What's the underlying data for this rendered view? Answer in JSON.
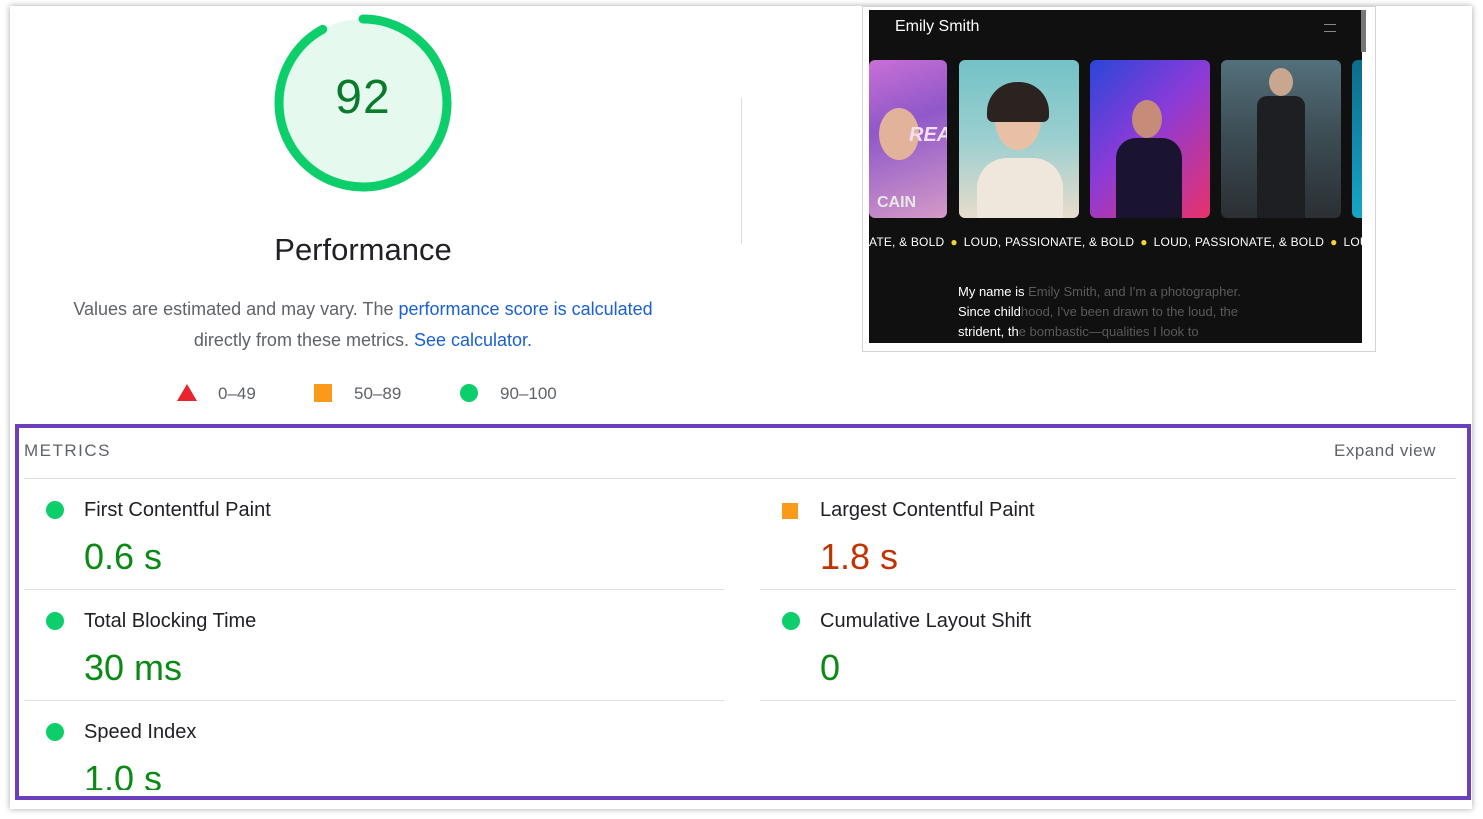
{
  "score": {
    "value": "92",
    "fraction": 0.92,
    "color": "#0cce6b"
  },
  "category_title": "Performance",
  "description": {
    "part1": "Values are estimated and may vary. The ",
    "link1": "performance score is calculated",
    "part2": "directly from these metrics. ",
    "link2": "See calculator."
  },
  "legend": {
    "fail": "0–49",
    "average": "50–89",
    "pass": "90–100"
  },
  "screenshot": {
    "site_name": "Emily Smith",
    "ticker_items": [
      "ATE, & BOLD",
      "LOUD, PASSIONATE, & BOLD",
      "LOUD, PASSIONATE, & BOLD",
      "LOUD"
    ],
    "photo_text_1": "CAIN",
    "photo_text_2": "REA",
    "bio_line1_bold": "My name is ",
    "bio_line1_dim": "Emily Smith, and I'm a photographer.",
    "bio_line2_bold": "Since child",
    "bio_line2_dim": "hood, I've been drawn to the loud, the",
    "bio_line3_bold": "strident, th",
    "bio_line3_dim": "e bombastic—qualities I look to"
  },
  "metrics": {
    "header": "METRICS",
    "expand": "Expand view",
    "items": [
      {
        "label": "First Contentful Paint",
        "value": "0.6 s",
        "status": "pass"
      },
      {
        "label": "Largest Contentful Paint",
        "value": "1.8 s",
        "status": "average"
      },
      {
        "label": "Total Blocking Time",
        "value": "30 ms",
        "status": "pass"
      },
      {
        "label": "Cumulative Layout Shift",
        "value": "0",
        "status": "pass"
      },
      {
        "label": "Speed Index",
        "value": "1.0 s",
        "status": "pass"
      }
    ]
  }
}
